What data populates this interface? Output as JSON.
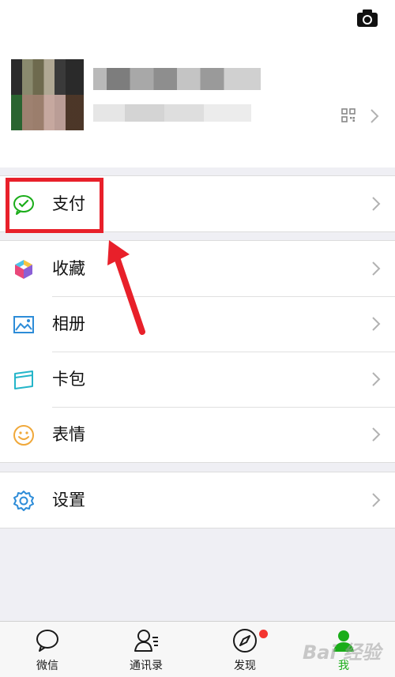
{
  "menu": {
    "payment": "支付",
    "favorites": "收藏",
    "album": "相册",
    "cards": "卡包",
    "stickers": "表情",
    "settings": "设置"
  },
  "tabs": [
    {
      "label": "微信"
    },
    {
      "label": "通讯录"
    },
    {
      "label": "发现"
    },
    {
      "label": "我"
    }
  ],
  "watermark": "Bai 经验",
  "colors": {
    "accent_green": "#1aad19",
    "annotation_red": "#e8202a",
    "badge_red": "#f43530"
  },
  "icons": {
    "header": "camera-icon",
    "profile": [
      "qr-code-icon",
      "chevron-right-icon"
    ],
    "menu": [
      "wechat-pay-icon",
      "favorites-cube-icon",
      "album-image-icon",
      "card-wallet-icon",
      "sticker-smile-icon",
      "settings-gear-icon"
    ],
    "tabs": [
      "chat-bubble-icon",
      "contacts-icon",
      "compass-icon",
      "me-person-icon"
    ]
  }
}
